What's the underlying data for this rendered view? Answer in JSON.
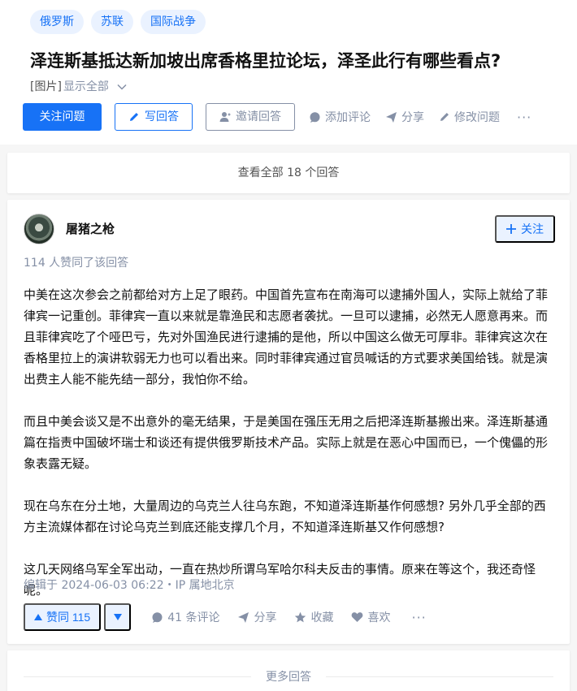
{
  "question": {
    "tags": [
      "俄罗斯",
      "苏联",
      "国际战争"
    ],
    "title": "泽连斯基抵达新加坡出席香格里拉论坛，泽圣此行有哪些看点?",
    "image_label": "[图片]",
    "show_all_label": "显示全部"
  },
  "question_actions": {
    "follow": "关注问题",
    "write_answer": "写回答",
    "invite": "邀请回答",
    "comment": "添加评论",
    "share": "分享",
    "edit": "修改问题"
  },
  "view_all_answers": "查看全部 18 个回答",
  "answer": {
    "author": "屠猪之枪",
    "follow_label": "关注",
    "votes_summary": "114 人赞同了该回答",
    "paragraphs": [
      "中美在这次参会之前都给对方上足了眼药。中国首先宣布在南海可以逮捕外国人，实际上就给了菲律宾一记重创。菲律宾一直以来就是靠渔民和志愿者袭扰。一旦可以逮捕，必然无人愿意再来。而且菲律宾吃了个哑巴亏，先对外国渔民进行逮捕的是他，所以中国这么做无可厚非。菲律宾这次在香格里拉上的演讲软弱无力也可以看出来。同时菲律宾通过官员喊话的方式要求美国给钱。就是演出费主人能不能先结一部分，我怕你不给。",
      "而且中美会谈又是不出意外的毫无结果，于是美国在强压无用之后把泽连斯基搬出来。泽连斯基通篇在指责中国破坏瑞士和谈还有提供俄罗斯技术产品。实际上就是在恶心中国而已，一个傀儡的形象表露无疑。",
      "现在乌东在分土地，大量周边的乌克兰人往乌东跑，不知道泽连斯基作何感想? 另外几乎全部的西方主流媒体都在讨论乌克兰到底还能支撑几个月，不知道泽连斯基又作何感想?",
      "这几天网络乌军全军出动，一直在热炒所谓乌军哈尔科夫反击的事情。原来在等这个，我还奇怪呢。"
    ],
    "edit_meta": "编辑于 2024-06-03 06:22・IP 属地北京",
    "upvote_label": "赞同 115",
    "comments_label": "41 条评论",
    "share_label": "分享",
    "favorite_label": "收藏",
    "like_label": "喜欢"
  },
  "more_answers": "更多回答",
  "colors": {
    "accent": "#1772f6",
    "accent_light": "#eaf2ff",
    "muted": "#8590a6",
    "background": "#f6f6f6"
  }
}
